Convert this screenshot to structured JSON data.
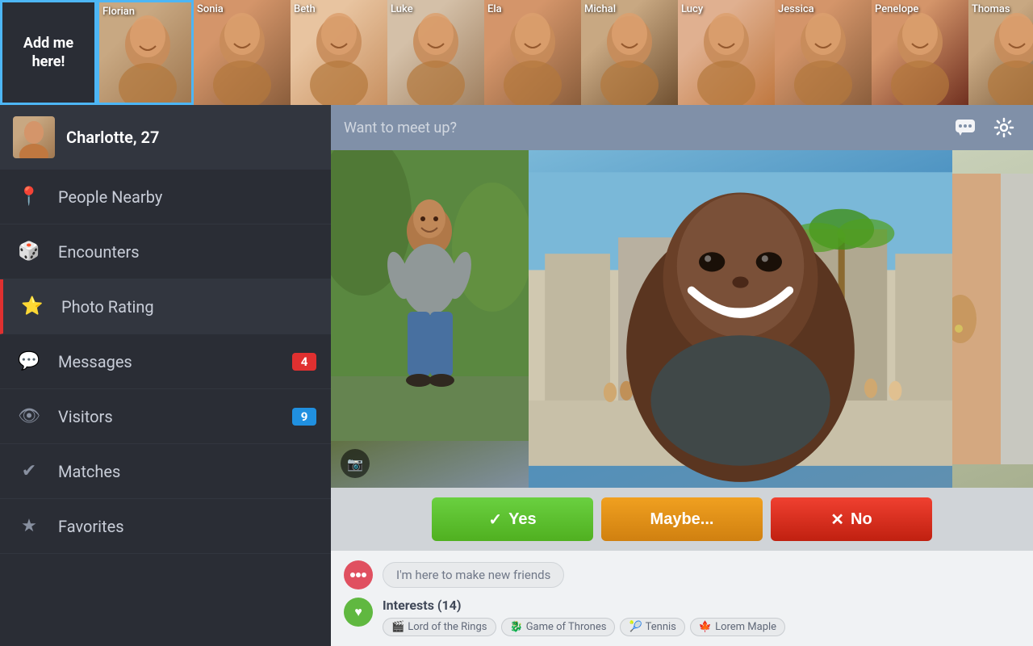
{
  "topStrip": {
    "addMe": {
      "label": "Add me\nhere!"
    },
    "persons": [
      {
        "name": "Florian",
        "colorClass": "face-florian"
      },
      {
        "name": "Sonia",
        "colorClass": "face-sonia"
      },
      {
        "name": "Beth",
        "colorClass": "face-beth"
      },
      {
        "name": "Luke",
        "colorClass": "face-luke"
      },
      {
        "name": "Ela",
        "colorClass": "face-ela"
      },
      {
        "name": "Michal",
        "colorClass": "face-michal"
      },
      {
        "name": "Lucy",
        "colorClass": "face-lucy"
      },
      {
        "name": "Jessica",
        "colorClass": "face-jessica"
      },
      {
        "name": "Penelope",
        "colorClass": "face-penelope"
      },
      {
        "name": "Thomas",
        "colorClass": "face-thomas"
      }
    ]
  },
  "sidebar": {
    "profile": {
      "name": "Charlotte, 27"
    },
    "navItems": [
      {
        "id": "people-nearby",
        "label": "People Nearby",
        "icon": "📍",
        "badge": null
      },
      {
        "id": "encounters",
        "label": "Encounters",
        "icon": "🎲",
        "badge": null
      },
      {
        "id": "photo-rating",
        "label": "Photo Rating",
        "icon": "⭐",
        "badge": null,
        "active": true
      },
      {
        "id": "messages",
        "label": "Messages",
        "icon": "💬",
        "badge": "4",
        "badgeColor": "red"
      },
      {
        "id": "visitors",
        "label": "Visitors",
        "icon": "👁",
        "badge": "9",
        "badgeColor": "blue"
      },
      {
        "id": "matches",
        "label": "Matches",
        "icon": "✔",
        "badge": null
      },
      {
        "id": "favorites",
        "label": "Favorites",
        "icon": "★",
        "badge": null
      }
    ]
  },
  "contentHeader": {
    "placeholder": "Want to meet up?",
    "chatIcon": "💬",
    "settingsIcon": "⚙"
  },
  "actionButtons": {
    "yes": "Yes",
    "maybe": "Maybe...",
    "no": "No"
  },
  "profileBottom": {
    "status": "I'm here to make new friends",
    "interestsTitle": "Interests (14)",
    "interestTags": [
      {
        "icon": "🎬",
        "label": "Lord of the Rings"
      },
      {
        "icon": "🐉",
        "label": "Game of Thrones"
      },
      {
        "icon": "🎾",
        "label": "Tennis"
      },
      {
        "icon": "🍁",
        "label": "Lorem Maple"
      }
    ]
  }
}
